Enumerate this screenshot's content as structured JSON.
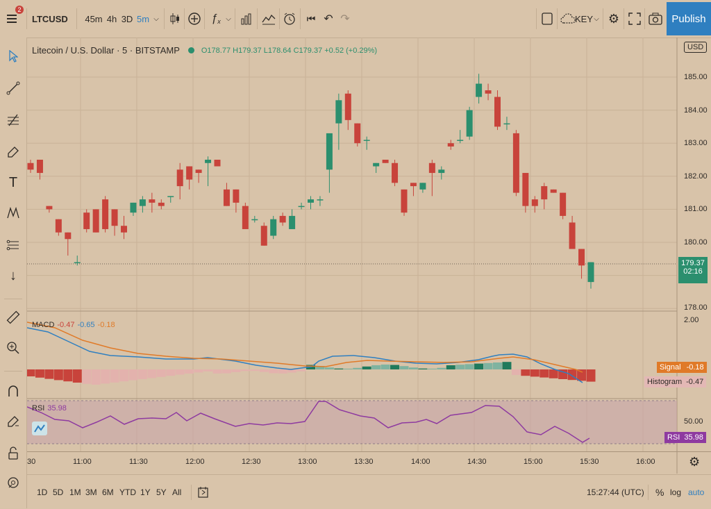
{
  "toolbar": {
    "menu_badge": "2",
    "symbol": "LTCUSD",
    "intervals": [
      "45m",
      "4h",
      "3D",
      "5m"
    ],
    "key_label": "KEY",
    "publish_label": "Publish"
  },
  "legend": {
    "title": "Litecoin / U.S. Dollar · 5 · BITSTAMP",
    "ohlc": "O178.77 H179.37 L178.64 C179.37 +0.52 (+0.29%)",
    "currency": "USD"
  },
  "price_axis": {
    "labels": [
      "185.00",
      "184.00",
      "183.00",
      "182.00",
      "181.00",
      "180.00",
      "178.00"
    ],
    "current_price": "179.37",
    "countdown": "02:16"
  },
  "macd": {
    "label": "MACD",
    "v1": "-0.47",
    "v2": "-0.65",
    "v3": "-0.18",
    "axis_label": "2.00",
    "signal_tag": "Signal",
    "signal_value": "-0.18",
    "histogram_tag": "Histogram",
    "histogram_value": "-0.47"
  },
  "rsi": {
    "label": "RSI",
    "value": "35.98",
    "axis_label": "50.00",
    "tag": "RSI",
    "tag_value": "35.98"
  },
  "time_axis": {
    "labels": [
      "11:00",
      "11:30",
      "12:00",
      "12:30",
      "13:00",
      "13:30",
      "14:00",
      "14:30",
      "15:00",
      "15:30",
      "16:00"
    ],
    "left_partial": "30"
  },
  "bottom": {
    "ranges": [
      "1D",
      "5D",
      "1M",
      "3M",
      "6M",
      "YTD",
      "1Y",
      "5Y",
      "All"
    ],
    "clock": "15:27:44 (UTC)",
    "percent": "%",
    "log": "log",
    "auto": "auto"
  },
  "colors": {
    "up": "#2b8f6e",
    "down": "#c8433b",
    "accent": "#2f7fc0",
    "macd_line": "#2f7fc0",
    "signal_line": "#e07a28",
    "rsi_line": "#8e3aa0"
  },
  "chart_data": {
    "type": "candlestick",
    "ohlc": [
      [
        182.4,
        182.5,
        182.1,
        182.2
      ],
      [
        182.5,
        182.5,
        181.9,
        182.1
      ],
      [
        181.1,
        181.1,
        180.9,
        181.0
      ],
      [
        180.7,
        180.7,
        180.2,
        180.3
      ],
      [
        180.3,
        180.3,
        179.6,
        180.1
      ],
      [
        179.4,
        179.6,
        179.3,
        179.4
      ],
      [
        180.9,
        181.0,
        180.3,
        180.4
      ],
      [
        181.0,
        181.0,
        180.3,
        180.3
      ],
      [
        181.3,
        181.4,
        180.3,
        180.4
      ],
      [
        181.0,
        181.0,
        180.2,
        180.5
      ],
      [
        180.5,
        180.8,
        180.1,
        180.3
      ],
      [
        180.9,
        181.2,
        180.8,
        181.2
      ],
      [
        181.1,
        181.4,
        180.9,
        181.3
      ],
      [
        181.3,
        181.5,
        180.9,
        181.2
      ],
      [
        181.2,
        181.3,
        181.0,
        181.1
      ],
      [
        181.4,
        181.4,
        181.2,
        181.4
      ],
      [
        182.2,
        182.4,
        181.3,
        181.7
      ],
      [
        182.3,
        182.3,
        181.6,
        181.9
      ],
      [
        182.2,
        182.2,
        181.8,
        182.1
      ],
      [
        182.4,
        182.6,
        181.7,
        182.5
      ],
      [
        182.5,
        182.5,
        182.3,
        182.3
      ],
      [
        181.6,
        181.8,
        181.1,
        181.1
      ],
      [
        181.6,
        181.6,
        180.9,
        181.2
      ],
      [
        181.1,
        181.2,
        180.6,
        180.4
      ],
      [
        180.7,
        180.8,
        180.6,
        180.7
      ],
      [
        180.5,
        180.6,
        179.9,
        179.9
      ],
      [
        180.2,
        180.8,
        180.1,
        180.7
      ],
      [
        180.8,
        180.9,
        180.5,
        180.6
      ],
      [
        180.4,
        181.0,
        180.4,
        180.8
      ],
      [
        181.1,
        181.2,
        181.0,
        181.1
      ],
      [
        181.2,
        181.4,
        181.0,
        181.3
      ],
      [
        181.3,
        181.4,
        181.1,
        181.3
      ],
      [
        182.2,
        183.2,
        181.5,
        183.3
      ],
      [
        183.6,
        184.5,
        182.8,
        184.3
      ],
      [
        184.5,
        184.6,
        183.4,
        183.7
      ],
      [
        183.6,
        183.6,
        182.9,
        183.0
      ],
      [
        183.1,
        183.2,
        182.8,
        183.1
      ],
      [
        182.3,
        182.4,
        182.1,
        182.4
      ],
      [
        182.5,
        182.5,
        182.4,
        182.4
      ],
      [
        182.4,
        182.5,
        181.7,
        181.8
      ],
      [
        181.6,
        181.6,
        180.8,
        180.9
      ],
      [
        181.8,
        181.8,
        181.4,
        181.7
      ],
      [
        181.6,
        181.8,
        181.5,
        181.8
      ],
      [
        182.4,
        182.5,
        181.4,
        182.1
      ],
      [
        182.1,
        182.3,
        181.9,
        182.2
      ],
      [
        183.0,
        183.1,
        182.8,
        182.9
      ],
      [
        183.1,
        183.4,
        183.0,
        183.1
      ],
      [
        183.2,
        184.1,
        183.1,
        184.0
      ],
      [
        184.4,
        185.1,
        184.2,
        184.8
      ],
      [
        184.6,
        184.8,
        184.3,
        184.5
      ],
      [
        184.4,
        184.6,
        183.4,
        183.5
      ],
      [
        183.6,
        183.8,
        183.4,
        183.6
      ],
      [
        183.3,
        183.4,
        181.4,
        181.5
      ],
      [
        182.1,
        182.1,
        180.9,
        181.1
      ],
      [
        181.3,
        181.4,
        180.9,
        181.1
      ],
      [
        181.7,
        181.8,
        181.0,
        181.3
      ],
      [
        181.6,
        181.6,
        181.5,
        181.5
      ],
      [
        181.5,
        181.5,
        180.7,
        180.8
      ],
      [
        180.6,
        180.8,
        179.9,
        179.8
      ],
      [
        179.8,
        179.8,
        178.9,
        179.3
      ],
      [
        178.8,
        179.4,
        178.6,
        179.4
      ]
    ]
  }
}
